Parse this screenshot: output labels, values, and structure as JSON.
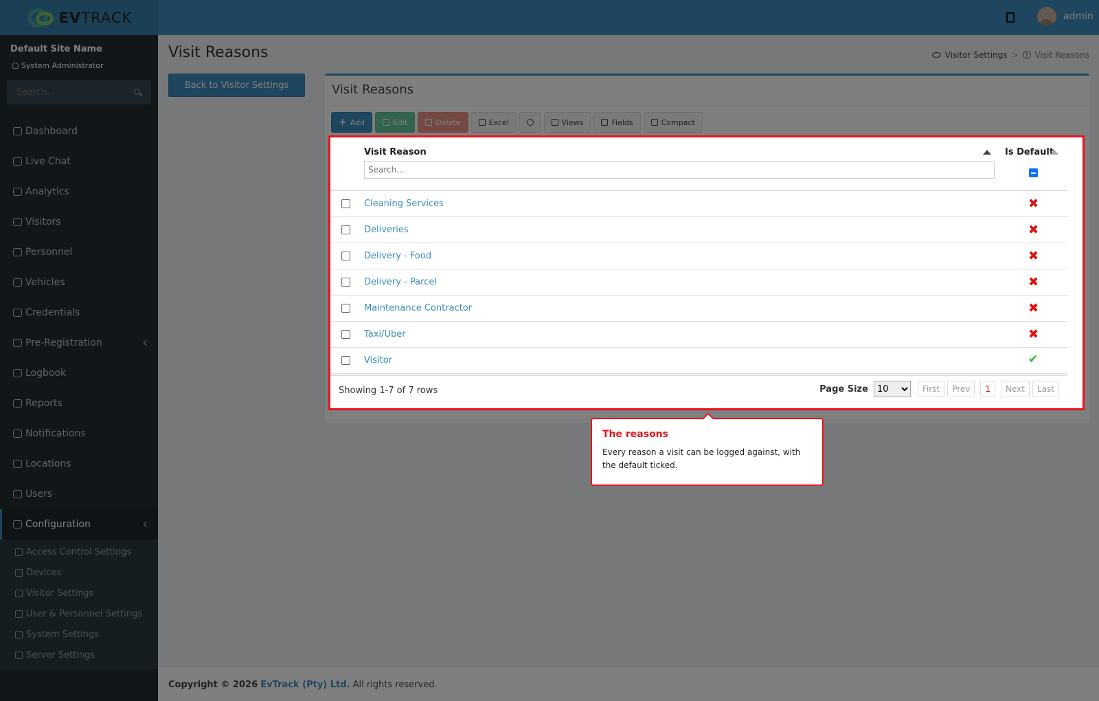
{
  "header": {
    "logo_prefix": "EV",
    "logo_suffix": "TRACK",
    "username": "admin"
  },
  "sidebar": {
    "site_name": "Default Site Name",
    "role": "System Administrator",
    "search_placeholder": "Search...",
    "items": [
      {
        "label": "Dashboard",
        "icon": "dashboard-icon"
      },
      {
        "label": "Live Chat",
        "icon": "headset-icon"
      },
      {
        "label": "Analytics",
        "icon": "analytics-icon"
      },
      {
        "label": "Visitors",
        "icon": "eye-icon"
      },
      {
        "label": "Personnel",
        "icon": "personnel-icon"
      },
      {
        "label": "Vehicles",
        "icon": "car-icon"
      },
      {
        "label": "Credentials",
        "icon": "id-card-icon"
      },
      {
        "label": "Pre-Registration",
        "icon": "arrows-icon"
      },
      {
        "label": "Logbook",
        "icon": "book-icon"
      },
      {
        "label": "Reports",
        "icon": "chart-icon"
      },
      {
        "label": "Notifications",
        "icon": "bell-icon"
      },
      {
        "label": "Locations",
        "icon": "map-icon"
      },
      {
        "label": "Users",
        "icon": "users-icon"
      },
      {
        "label": "Configuration",
        "icon": "gear-icon"
      }
    ],
    "sub_items": [
      {
        "label": "Access Control Settings",
        "icon": "lock-icon"
      },
      {
        "label": "Devices",
        "icon": "device-icon"
      },
      {
        "label": "Visitor Settings",
        "icon": "eye-icon"
      },
      {
        "label": "User & Personnel Settings",
        "icon": "user-gear-icon"
      },
      {
        "label": "System Settings",
        "icon": "sliders-icon"
      },
      {
        "label": "Server Settings",
        "icon": "server-icon"
      }
    ]
  },
  "page": {
    "title": "Visit Reasons",
    "breadcrumb_parent": "Visitor Settings",
    "breadcrumb_current": "Visit Reasons",
    "back_button": "Back to Visitor Settings"
  },
  "box": {
    "title": "Visit Reasons",
    "toolbar": {
      "add": "Add",
      "edit": "Edit",
      "delete": "Delete",
      "excel": "Excel",
      "views": "Views",
      "fields": "Fields",
      "compact": "Compact"
    }
  },
  "table": {
    "col_reason": "Visit Reason",
    "col_default": "Is Default",
    "search_placeholder": "Search...",
    "rows": [
      {
        "reason": "Cleaning Services",
        "is_default": false
      },
      {
        "reason": "Deliveries",
        "is_default": false
      },
      {
        "reason": "Delivery - Food",
        "is_default": false
      },
      {
        "reason": "Delivery - Parcel",
        "is_default": false
      },
      {
        "reason": "Maintenance Contractor",
        "is_default": false
      },
      {
        "reason": "Taxi/Uber",
        "is_default": false
      },
      {
        "reason": "Visitor",
        "is_default": true
      }
    ],
    "showing": "Showing 1-7 of 7 rows",
    "page_size_label": "Page Size",
    "page_size": "10",
    "pager": {
      "first": "First",
      "prev": "Prev",
      "current": "1",
      "next": "Next",
      "last": "Last"
    }
  },
  "footer": {
    "copyright": "Copyright © 2026",
    "company": "EvTrack (Pty) Ltd.",
    "rights": "All rights reserved."
  },
  "tooltip": {
    "title": "The reasons",
    "text": "Every reason a visit can be logged against, with the default ticked."
  },
  "colors": {
    "accent": "#3c8dbc",
    "highlight": "#e8131e",
    "sidebar": "#222d32"
  }
}
